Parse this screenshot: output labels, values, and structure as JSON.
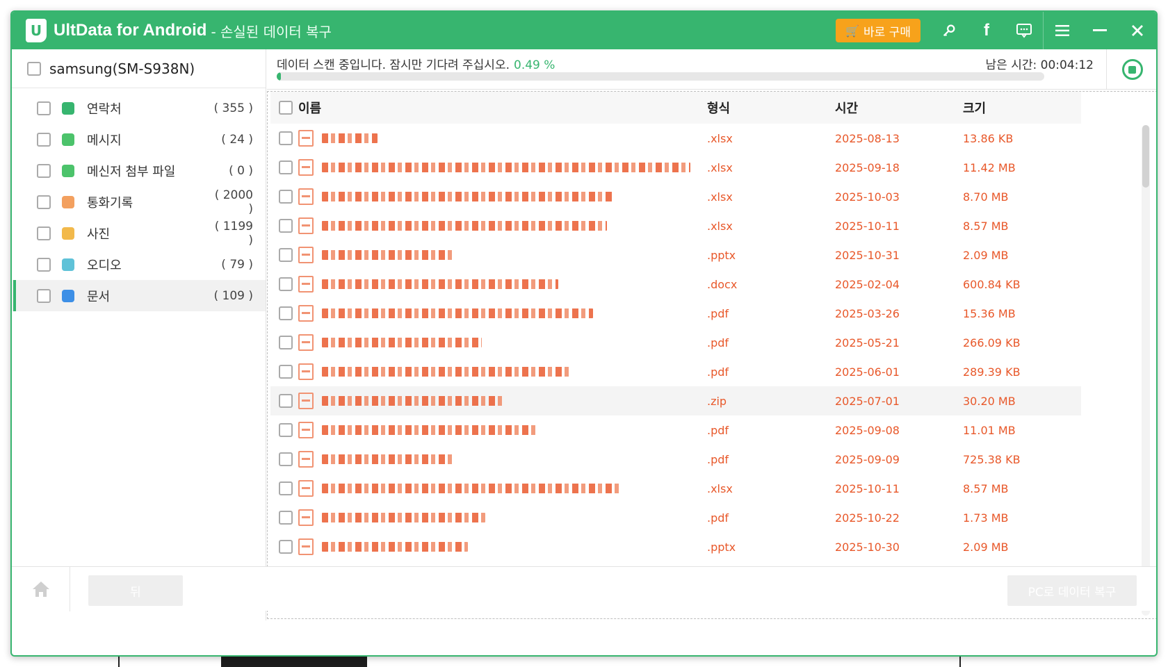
{
  "window": {
    "app_logo": "U",
    "app_title": "UltData for Android",
    "app_subtitle": "- 손실된 데이터 복구",
    "buy_label": "바로 구매",
    "brand_color": "#37b56f",
    "buy_color": "#f7a21b"
  },
  "icons": {
    "key": "key-icon",
    "facebook": "facebook-icon",
    "feedback": "feedback-icon",
    "menu": "menu-icon",
    "minimize": "minimize-icon",
    "close": "close-icon"
  },
  "device": {
    "name": "samsung(SM-S938N)"
  },
  "categories": [
    {
      "label": "연락처",
      "count": "( 355 )",
      "icon": "contacts-icon",
      "color": "#37b56f"
    },
    {
      "label": "메시지",
      "count": "( 24 )",
      "icon": "message-icon",
      "color": "#4cc36b"
    },
    {
      "label": "메신저 첨부 파일",
      "count": "( 0 )",
      "icon": "attachment-icon",
      "color": "#4cc36b"
    },
    {
      "label": "통화기록",
      "count": "( 2000 )",
      "icon": "call-log-icon",
      "color": "#f3a05f"
    },
    {
      "label": "사진",
      "count": "( 1199 )",
      "icon": "photo-icon",
      "color": "#f2b94b"
    },
    {
      "label": "오디오",
      "count": "( 79 )",
      "icon": "audio-icon",
      "color": "#5fc2d8"
    },
    {
      "label": "문서",
      "count": "( 109 )",
      "icon": "document-icon",
      "color": "#3d8fe6"
    }
  ],
  "scan": {
    "status_text": "데이터 스캔 중입니다. 잠시만 기다려 주십시오.",
    "percent_text": "0.49 %",
    "progress": 0.0049,
    "remaining_label": "남은 시간:",
    "remaining_value": "00:04:12"
  },
  "table": {
    "headers": {
      "name": "이름",
      "type": "형식",
      "time": "시간",
      "size": "크기"
    },
    "rows": [
      {
        "type": ".xlsx",
        "time": "2025-08-13",
        "size": "13.86 KB"
      },
      {
        "type": ".xlsx",
        "time": "2025-09-18",
        "size": "11.42 MB"
      },
      {
        "type": ".xlsx",
        "time": "2025-10-03",
        "size": "8.70 MB"
      },
      {
        "type": ".xlsx",
        "time": "2025-10-11",
        "size": "8.57 MB"
      },
      {
        "type": ".pptx",
        "time": "2025-10-31",
        "size": "2.09 MB"
      },
      {
        "type": ".docx",
        "time": "2025-02-04",
        "size": "600.84 KB"
      },
      {
        "type": ".pdf",
        "time": "2025-03-26",
        "size": "15.36 MB"
      },
      {
        "type": ".pdf",
        "time": "2025-05-21",
        "size": "266.09 KB"
      },
      {
        "type": ".pdf",
        "time": "2025-06-01",
        "size": "289.39 KB"
      },
      {
        "type": ".zip",
        "time": "2025-07-01",
        "size": "30.20 MB"
      },
      {
        "type": ".pdf",
        "time": "2025-09-08",
        "size": "11.01 MB"
      },
      {
        "type": ".pdf",
        "time": "2025-09-09",
        "size": "725.38 KB"
      },
      {
        "type": ".xlsx",
        "time": "2025-10-11",
        "size": "8.57 MB"
      },
      {
        "type": ".pdf",
        "time": "2025-10-22",
        "size": "1.73 MB"
      },
      {
        "type": ".pptx",
        "time": "2025-10-30",
        "size": "2.09 MB"
      }
    ]
  },
  "footer": {
    "back_label": "뒤",
    "recover_label": "PC로 데이터 복구"
  }
}
